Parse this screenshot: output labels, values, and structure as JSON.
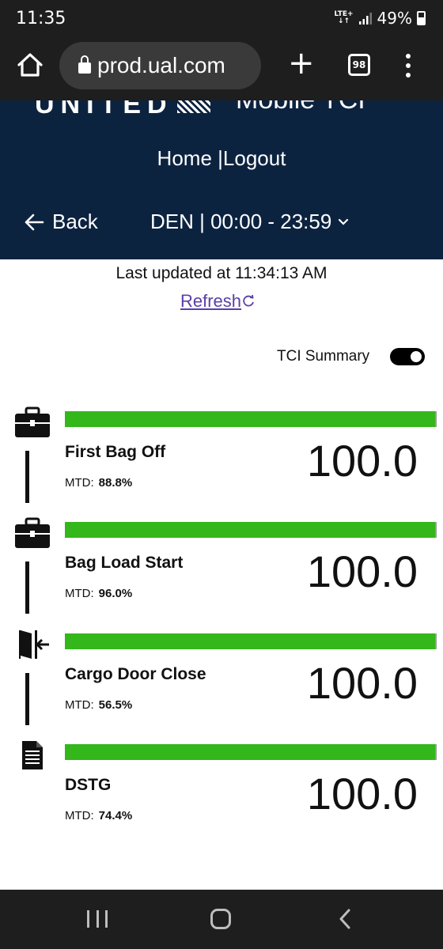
{
  "status_bar": {
    "time": "11:35",
    "network": "LTE+",
    "battery": "49%"
  },
  "browser": {
    "url": "prod.ual.com",
    "tab_count": "98"
  },
  "header": {
    "logo_text": "UNITED",
    "app_title": "Mobile TCI",
    "nav_home": "Home",
    "nav_separator": "|",
    "nav_logout": "Logout",
    "back_label": "Back",
    "station_window": "DEN | 00:00 - 23:59"
  },
  "info": {
    "last_updated": "Last updated at 11:34:13 AM",
    "refresh_label": "Refresh"
  },
  "summary": {
    "label": "TCI Summary",
    "enabled": true
  },
  "colors": {
    "header_bg": "#0c2340",
    "bar_green": "#33b71a",
    "link_purple": "#5b3fa8"
  },
  "metrics": [
    {
      "name": "First Bag Off",
      "mtd_label": "MTD:",
      "mtd_value": "88.8%",
      "score": "100.0",
      "fill_percent": 100,
      "icon": "briefcase-icon"
    },
    {
      "name": "Bag Load Start",
      "mtd_label": "MTD:",
      "mtd_value": "96.0%",
      "score": "100.0",
      "fill_percent": 100,
      "icon": "briefcase-icon"
    },
    {
      "name": "Cargo Door Close",
      "mtd_label": "MTD:",
      "mtd_value": "56.5%",
      "score": "100.0",
      "fill_percent": 100,
      "icon": "door-enter-icon"
    },
    {
      "name": "DSTG",
      "mtd_label": "MTD:",
      "mtd_value": "74.4%",
      "score": "100.0",
      "fill_percent": 100,
      "icon": "document-icon"
    }
  ]
}
